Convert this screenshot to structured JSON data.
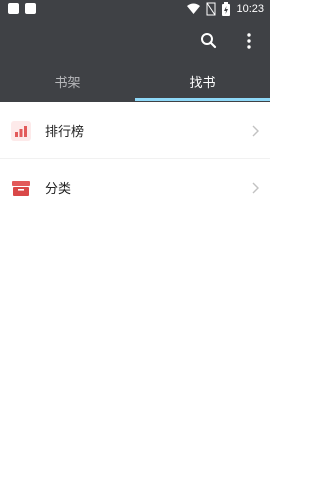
{
  "status_bar": {
    "time": "10:23",
    "icons": [
      "notification-square-icon",
      "notification-square-icon",
      "wifi-icon",
      "no-signal-icon",
      "battery-charging-icon"
    ]
  },
  "toolbar": {
    "search_icon": "search-icon",
    "more_icon": "more-vert-icon"
  },
  "tabs": [
    {
      "label": "书架",
      "selected": false
    },
    {
      "label": "找书",
      "selected": true
    }
  ],
  "menu": {
    "items": [
      {
        "label": "排行榜",
        "icon": "ranking-chart-icon"
      },
      {
        "label": "分类",
        "icon": "category-box-icon"
      }
    ]
  },
  "colors": {
    "bar_bg": "#3f4145",
    "tab_indicator": "#8ed8f8",
    "icon_red": "#e25a5a"
  }
}
